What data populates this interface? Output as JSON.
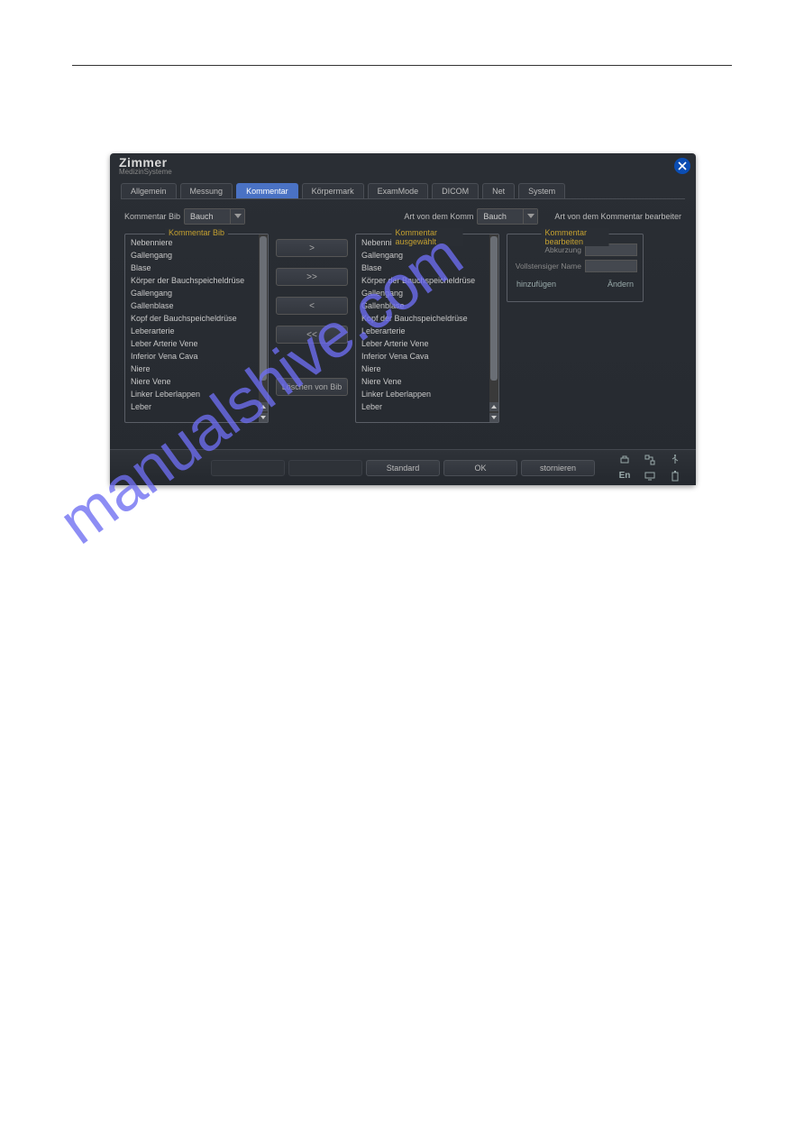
{
  "brand": {
    "name": "Zimmer",
    "sub": "MedizinSysteme"
  },
  "title_center": "",
  "tabs": [
    {
      "label": "Allgemein"
    },
    {
      "label": "Messung"
    },
    {
      "label": "Kommentar"
    },
    {
      "label": "Körpermark"
    },
    {
      "label": "ExamMode"
    },
    {
      "label": "DICOM"
    },
    {
      "label": "Net"
    },
    {
      "label": "System"
    }
  ],
  "labels": {
    "kommentar_bib": "Kommentar  Bib",
    "art_komm": "Art von dem Komm",
    "edit_kind": "Art von dem Kommentar bearbeiter"
  },
  "select_bib": "Bauch",
  "select_art": "Bauch",
  "legend_bib": "Kommentar  Bib",
  "legend_sel": "Kommentar ausgewählt",
  "legend_edit": "Kommentar bearbeiten",
  "list_bib": [
    "Nebenniere",
    "Gallengang",
    "Blase",
    "Körper der Bauchspeicheldrüse",
    "Gallengang",
    "Gallenblase",
    "Kopf der Bauchspeicheldrüse",
    "Leberarterie",
    "Leber Arterie Vene",
    "Inferior Vena Cava",
    "Niere",
    "Niere Vene",
    "Linker Leberlappen",
    "Leber"
  ],
  "list_sel": [
    "Nebenniere",
    "Gallengang",
    "Blase",
    "Körper der Bauchspeicheldrüse",
    "Gallengang",
    "Gallenblase",
    "Kopf der Bauchspeicheldrüse",
    "Leberarterie",
    "Leber Arterie Vene",
    "Inferior Vena Cava",
    "Niere",
    "Niere Vene",
    "Linker Leberlappen",
    "Leber"
  ],
  "movers": {
    "r": ">",
    "rr": ">>",
    "l": "<",
    "ll": "<<",
    "del": "Löschen von Bib"
  },
  "edit": {
    "abk_label": "Abkurzung",
    "voll_label": "Vollstensiger Name",
    "add": "hinzufügen",
    "mod": "Ändern"
  },
  "bottom": {
    "standard": "Standard",
    "ok": "OK",
    "cancel": "stornieren"
  },
  "status": {
    "lang": "En"
  },
  "watermark": "manualshive.com"
}
